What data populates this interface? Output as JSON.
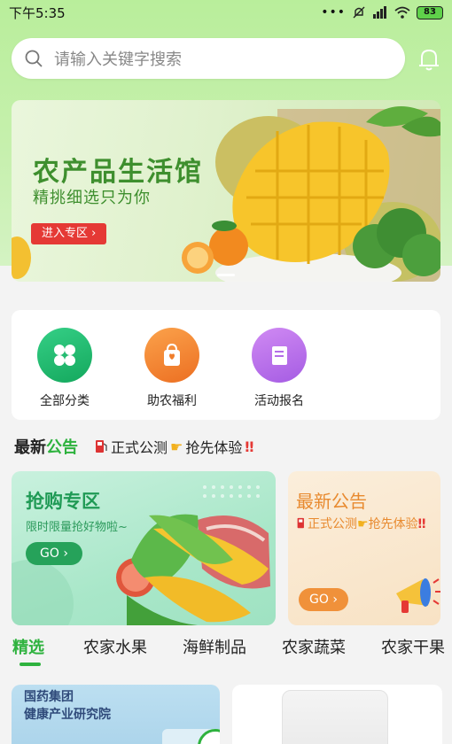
{
  "status_bar": {
    "time": "下午5:35",
    "battery": "83"
  },
  "search": {
    "placeholder": "请输入关键字搜索"
  },
  "banner": {
    "title": "农产品生活馆",
    "subtitle": "精挑细选只为你",
    "button": "进入专区 ›"
  },
  "categories": [
    {
      "label": "全部分类",
      "icon": "grid-icon",
      "color": "#1fb870"
    },
    {
      "label": "助农福利",
      "icon": "gift-bag-icon",
      "color": "#f07e2c"
    },
    {
      "label": "活动报名",
      "icon": "form-icon",
      "color": "#b46ee8"
    }
  ],
  "notice": {
    "brand_dark": "最新",
    "brand_green": "公告",
    "text_a": "正式公测",
    "text_b": "抢先体验"
  },
  "promo_left": {
    "title": "抢购专区",
    "subtitle": "限时限量抢好物啦~",
    "go": "GO ›"
  },
  "promo_right": {
    "title": "最新公告",
    "text_a": "正式公测",
    "text_b": "抢先体验",
    "go": "GO ›"
  },
  "tabs": [
    "精选",
    "农家水果",
    "海鲜制品",
    "农家蔬菜",
    "农家干果"
  ],
  "products": {
    "left_line1": "国药集团",
    "left_line2": "健康产业研究院"
  },
  "colors": {
    "brand_green": "#2eb23e",
    "accent_red": "#e53935",
    "accent_orange": "#f0913a"
  }
}
